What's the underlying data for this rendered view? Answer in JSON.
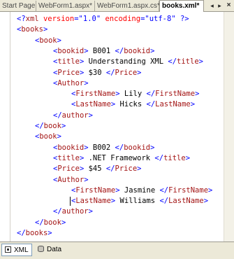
{
  "tabs": [
    {
      "label": "Start Page"
    },
    {
      "label": "WebForm1.aspx*"
    },
    {
      "label": "WebForm1.aspx.cs*"
    },
    {
      "label": "books.xml*"
    }
  ],
  "tab_controls": {
    "prev": "◂",
    "next": "▸",
    "close": "×"
  },
  "editor": {
    "lines": [
      {
        "indent": 0,
        "kind": "decl",
        "text": "<?xml version=\"1.0\" encoding=\"utf-8\" ?>"
      },
      {
        "indent": 0,
        "kind": "open",
        "tag": "books"
      },
      {
        "indent": 1,
        "kind": "open",
        "tag": "book"
      },
      {
        "indent": 2,
        "kind": "elem",
        "tag": "bookid",
        "value": "B001"
      },
      {
        "indent": 2,
        "kind": "elem",
        "tag": "title",
        "value": "Understanding XML"
      },
      {
        "indent": 2,
        "kind": "elem",
        "tag": "Price",
        "value": "$30"
      },
      {
        "indent": 2,
        "kind": "open",
        "tag": "Author"
      },
      {
        "indent": 3,
        "kind": "elem",
        "tag": "FirstName",
        "value": "Lily"
      },
      {
        "indent": 3,
        "kind": "elem",
        "tag": "LastName",
        "value": "Hicks"
      },
      {
        "indent": 2,
        "kind": "close",
        "tag": "author"
      },
      {
        "indent": 1,
        "kind": "close",
        "tag": "book"
      },
      {
        "indent": 1,
        "kind": "open",
        "tag": "book"
      },
      {
        "indent": 2,
        "kind": "elem",
        "tag": "bookid",
        "value": "B002"
      },
      {
        "indent": 2,
        "kind": "elem",
        "tag": "title",
        "value": ".NET Framework"
      },
      {
        "indent": 2,
        "kind": "elem",
        "tag": "Price",
        "value": "$45"
      },
      {
        "indent": 2,
        "kind": "open",
        "tag": "Author"
      },
      {
        "indent": 3,
        "kind": "elem",
        "tag": "FirstName",
        "value": "Jasmine"
      },
      {
        "indent": 3,
        "kind": "elem",
        "tag": "LastName",
        "value": "Williams",
        "caret": true
      },
      {
        "indent": 2,
        "kind": "close",
        "tag": "author"
      },
      {
        "indent": 1,
        "kind": "close",
        "tag": "book"
      },
      {
        "indent": 0,
        "kind": "close",
        "tag": "books"
      }
    ]
  },
  "views": [
    {
      "label": "XML",
      "icon": "xml-view-icon",
      "active": true
    },
    {
      "label": "Data",
      "icon": "data-view-icon",
      "active": false
    }
  ],
  "colors": {
    "delimiter": "#0000ff",
    "element": "#a31515",
    "attribute": "#ff0000",
    "attr_value": "#0000ff",
    "text": "#000000"
  }
}
